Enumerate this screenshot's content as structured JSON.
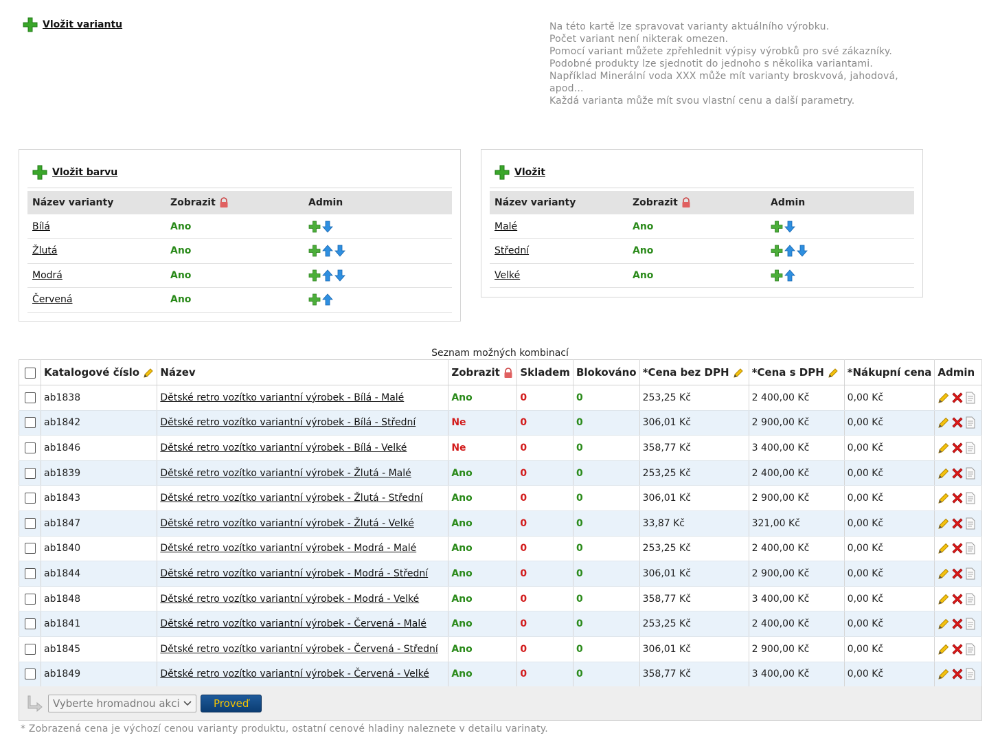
{
  "top": {
    "add_variant_label": "Vložit variantu",
    "info_lines": [
      "Na této kartě lze spravovat varianty aktuálního výrobku.",
      "Počet variant není nikterak omezen.",
      "Pomocí variant můžete zpřehlednit výpisy výrobků pro své zákazníky.",
      "Podobné produkty lze sjednotit do jednoho s několika variantami.",
      "Například Minerální voda XXX může mít varianty broskvová, jahodová,",
      "apod...",
      "Každá varianta může mít svou vlastní cenu a další parametry."
    ]
  },
  "variant_groups": [
    {
      "add_label": "Vložit barvu",
      "headers": {
        "name": "Název varianty",
        "show": "Zobrazit",
        "admin": "Admin"
      },
      "rows": [
        {
          "name": "Bílá",
          "show": "Ano",
          "icons": [
            "plus-icon",
            "arrow-down-icon"
          ]
        },
        {
          "name": "Žlutá",
          "show": "Ano",
          "icons": [
            "plus-icon",
            "arrow-up-icon",
            "arrow-down-icon"
          ]
        },
        {
          "name": "Modrá",
          "show": "Ano",
          "icons": [
            "plus-icon",
            "arrow-up-icon",
            "arrow-down-icon"
          ]
        },
        {
          "name": "Červená",
          "show": "Ano",
          "icons": [
            "plus-icon",
            "arrow-up-icon"
          ]
        }
      ]
    },
    {
      "add_label": "Vložit",
      "headers": {
        "name": "Název varianty",
        "show": "Zobrazit",
        "admin": "Admin"
      },
      "rows": [
        {
          "name": "Malé",
          "show": "Ano",
          "icons": [
            "plus-icon",
            "arrow-down-icon"
          ]
        },
        {
          "name": "Střední",
          "show": "Ano",
          "icons": [
            "plus-icon",
            "arrow-up-icon",
            "arrow-down-icon"
          ]
        },
        {
          "name": "Velké",
          "show": "Ano",
          "icons": [
            "plus-icon",
            "arrow-up-icon"
          ]
        }
      ]
    }
  ],
  "combinations": {
    "caption": "Seznam možných kombinací",
    "headers": {
      "catalog": "Katalogové číslo",
      "name": "Název",
      "show": "Zobrazit",
      "stock": "Skladem",
      "blocked": "Blokováno",
      "price_net": "*Cena bez DPH",
      "price_gross": "*Cena s DPH",
      "purchase": "*Nákupní cena",
      "admin": "Admin"
    },
    "rows": [
      {
        "catalog": "ab1838",
        "name": "Dětské retro vozítko variantní výrobek - Bílá - Malé",
        "show": "Ano",
        "stock": "0",
        "blocked": "0",
        "price_net": "253,25 Kč",
        "price_gross": "2 400,00 Kč",
        "purchase": "0,00 Kč"
      },
      {
        "catalog": "ab1842",
        "name": "Dětské retro vozítko variantní výrobek - Bílá - Střední",
        "show": "Ne",
        "stock": "0",
        "blocked": "0",
        "price_net": "306,01 Kč",
        "price_gross": "2 900,00 Kč",
        "purchase": "0,00 Kč"
      },
      {
        "catalog": "ab1846",
        "name": "Dětské retro vozítko variantní výrobek - Bílá - Velké",
        "show": "Ne",
        "stock": "0",
        "blocked": "0",
        "price_net": "358,77 Kč",
        "price_gross": "3 400,00 Kč",
        "purchase": "0,00 Kč"
      },
      {
        "catalog": "ab1839",
        "name": "Dětské retro vozítko variantní výrobek - Žlutá - Malé",
        "show": "Ano",
        "stock": "0",
        "blocked": "0",
        "price_net": "253,25 Kč",
        "price_gross": "2 400,00 Kč",
        "purchase": "0,00 Kč"
      },
      {
        "catalog": "ab1843",
        "name": "Dětské retro vozítko variantní výrobek - Žlutá - Střední",
        "show": "Ano",
        "stock": "0",
        "blocked": "0",
        "price_net": "306,01 Kč",
        "price_gross": "2 900,00 Kč",
        "purchase": "0,00 Kč"
      },
      {
        "catalog": "ab1847",
        "name": "Dětské retro vozítko variantní výrobek - Žlutá - Velké",
        "show": "Ano",
        "stock": "0",
        "blocked": "0",
        "price_net": "33,87 Kč",
        "price_gross": "321,00 Kč",
        "purchase": "0,00 Kč"
      },
      {
        "catalog": "ab1840",
        "name": "Dětské retro vozítko variantní výrobek - Modrá - Malé",
        "show": "Ano",
        "stock": "0",
        "blocked": "0",
        "price_net": "253,25 Kč",
        "price_gross": "2 400,00 Kč",
        "purchase": "0,00 Kč"
      },
      {
        "catalog": "ab1844",
        "name": "Dětské retro vozítko variantní výrobek - Modrá - Střední",
        "show": "Ano",
        "stock": "0",
        "blocked": "0",
        "price_net": "306,01 Kč",
        "price_gross": "2 900,00 Kč",
        "purchase": "0,00 Kč"
      },
      {
        "catalog": "ab1848",
        "name": "Dětské retro vozítko variantní výrobek - Modrá - Velké",
        "show": "Ano",
        "stock": "0",
        "blocked": "0",
        "price_net": "358,77 Kč",
        "price_gross": "3 400,00 Kč",
        "purchase": "0,00 Kč"
      },
      {
        "catalog": "ab1841",
        "name": "Dětské retro vozítko variantní výrobek - Červená - Malé",
        "show": "Ano",
        "stock": "0",
        "blocked": "0",
        "price_net": "253,25 Kč",
        "price_gross": "2 400,00 Kč",
        "purchase": "0,00 Kč"
      },
      {
        "catalog": "ab1845",
        "name": "Dětské retro vozítko variantní výrobek - Červená - Střední",
        "show": "Ano",
        "stock": "0",
        "blocked": "0",
        "price_net": "306,01 Kč",
        "price_gross": "2 900,00 Kč",
        "purchase": "0,00 Kč"
      },
      {
        "catalog": "ab1849",
        "name": "Dětské retro vozítko variantní výrobek - Červená - Velké",
        "show": "Ano",
        "stock": "0",
        "blocked": "0",
        "price_net": "358,77 Kč",
        "price_gross": "3 400,00 Kč",
        "purchase": "0,00 Kč"
      }
    ],
    "bulk_select_label": "Vyberte hromadnou akci",
    "bulk_button_label": "Proveď"
  },
  "footnote": "* Zobrazená cena je výchozí cenou varianty produktu, ostatní cenové hladiny naleznete v detailu varinaty.",
  "colors": {
    "yes": "#2a8a1a",
    "no": "#d21a1a",
    "row_alt": "#e9f2fa",
    "header_bg": "#e3e3e3",
    "info_text": "#8a8a8a"
  }
}
